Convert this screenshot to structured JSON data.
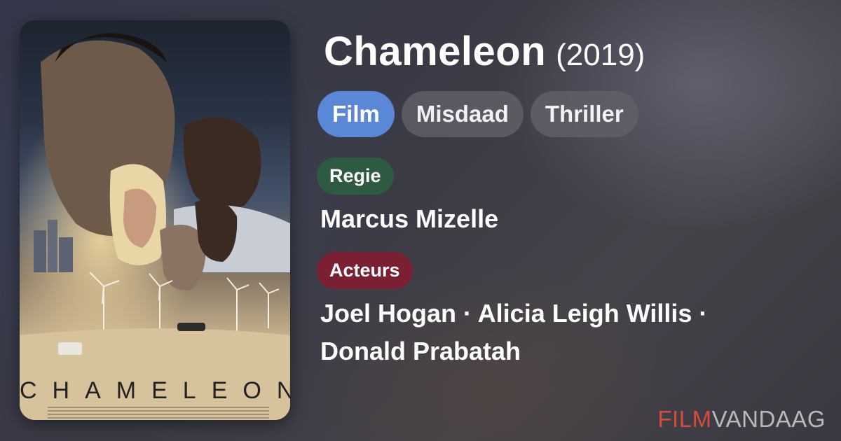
{
  "movie": {
    "title": "Chameleon",
    "year": "(2019)"
  },
  "tags": [
    "Film",
    "Misdaad",
    "Thriller"
  ],
  "director_section": {
    "label": "Regie",
    "names": "Marcus Mizelle"
  },
  "cast_section": {
    "label": "Acteurs",
    "line1": "Joel Hogan · Alicia Leigh Willis ·",
    "line2": "Donald Prabatah"
  },
  "poster": {
    "title_text": "CHAMELEON"
  },
  "brand": {
    "part1": "FILM",
    "part2": "VANDAAG",
    "colors": {
      "film": "#d9493c",
      "vandaag": "#b9b9bd"
    }
  },
  "colors": {
    "tag_primary": "#5b88d6",
    "regie_badge": "#2d5a40",
    "acteurs_badge": "#7b1f33"
  }
}
